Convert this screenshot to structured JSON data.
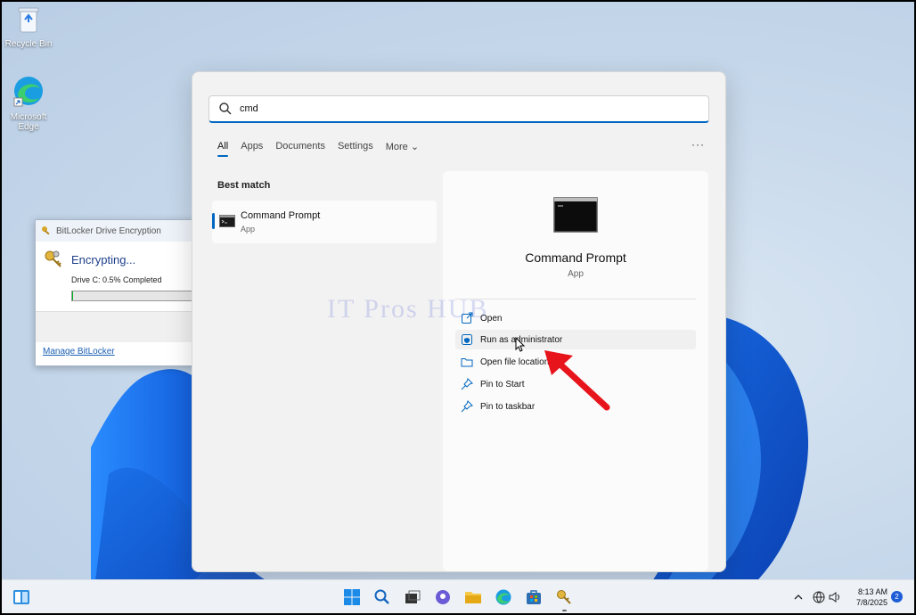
{
  "desktop": {
    "icons": [
      {
        "label": "Recycle Bin",
        "icon": "recycle-bin-icon"
      },
      {
        "label": "Microsoft Edge",
        "icon": "edge-icon"
      }
    ]
  },
  "bitlocker": {
    "title": "BitLocker Drive Encryption",
    "status": "Encrypting...",
    "drive_line": "Drive C: 0.5% Completed",
    "progress": 0.005,
    "manage_link": "Manage BitLocker"
  },
  "search": {
    "query": "cmd",
    "tabs": [
      {
        "label": "All",
        "active": true
      },
      {
        "label": "Apps"
      },
      {
        "label": "Documents"
      },
      {
        "label": "Settings"
      },
      {
        "label": "More ⌄"
      }
    ],
    "more_options": "···",
    "best_match_label": "Best match",
    "best_match": {
      "name": "Command Prompt",
      "kind": "App",
      "icon": "cmd-icon"
    },
    "detail": {
      "name": "Command Prompt",
      "kind": "App",
      "actions": [
        {
          "label": "Open",
          "icon": "open-external-icon"
        },
        {
          "label": "Run as administrator",
          "icon": "shield-admin-icon"
        },
        {
          "label": "Open file location",
          "icon": "folder-icon"
        },
        {
          "label": "Pin to Start",
          "icon": "pin-icon"
        },
        {
          "label": "Pin to taskbar",
          "icon": "pin-icon"
        }
      ]
    }
  },
  "watermark": "IT Pros HUB",
  "taskbar": {
    "time": "8:13 AM",
    "date": "7/8/2025",
    "notification_count": "2"
  },
  "colors": {
    "accent": "#0067c0",
    "arrow": "#e8141c"
  }
}
